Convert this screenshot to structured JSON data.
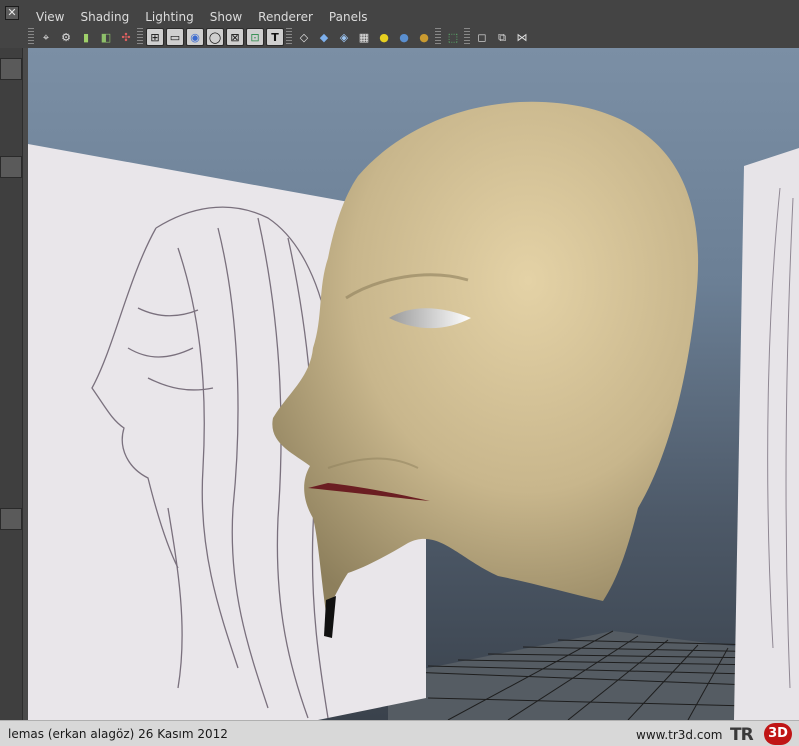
{
  "menubar": {
    "items": [
      "View",
      "Shading",
      "Lighting",
      "Show",
      "Renderer",
      "Panels"
    ]
  },
  "panel": {
    "close_glyph": "✕"
  },
  "toolbar": {
    "tools": [
      {
        "icon": "camera-select-icon",
        "glyph": "⌖"
      },
      {
        "icon": "camera-attributes-icon",
        "glyph": "⚙"
      },
      {
        "icon": "bookmarks-icon",
        "glyph": "▮"
      },
      {
        "icon": "image-plane-icon",
        "glyph": "◧"
      },
      {
        "icon": "camera-tools-icon",
        "glyph": "✣"
      },
      {
        "icon": "grid-toggle-icon",
        "glyph": "⊞"
      },
      {
        "icon": "film-gate-icon",
        "glyph": "▭"
      },
      {
        "icon": "resolution-gate-icon",
        "glyph": "◉"
      },
      {
        "icon": "gate-mask-icon",
        "glyph": "◯"
      },
      {
        "icon": "field-chart-icon",
        "glyph": "⊠"
      },
      {
        "icon": "safe-action-icon",
        "glyph": "⊡"
      },
      {
        "icon": "safe-title-icon",
        "glyph": "T"
      },
      {
        "icon": "wireframe-icon",
        "glyph": "◇"
      },
      {
        "icon": "smooth-shade-icon",
        "glyph": "◆"
      },
      {
        "icon": "shade-wireframe-icon",
        "glyph": "◈"
      },
      {
        "icon": "textured-icon",
        "glyph": "▦"
      },
      {
        "icon": "default-lighting-icon",
        "glyph": "●"
      },
      {
        "icon": "all-lights-icon",
        "glyph": "●"
      },
      {
        "icon": "shadows-icon",
        "glyph": "●"
      },
      {
        "icon": "isolate-select-icon",
        "glyph": "⬚"
      },
      {
        "icon": "xray-icon",
        "glyph": "◻"
      },
      {
        "icon": "xray-joints-icon",
        "glyph": "⧉"
      },
      {
        "icon": "xray-active-icon",
        "glyph": "⋈"
      }
    ]
  },
  "colors": {
    "viewport_top": "#7b8fa5",
    "viewport_bottom": "#3a424c",
    "head_skin": "#c8b68c",
    "accent_yellow": "#e8d020",
    "accent_blue": "#5a8fd0",
    "accent_gold": "#c99a30",
    "logo_red": "#c01515"
  },
  "statusbar": {
    "credit": "lemas (erkan alagöz)  26 Kasım 2012",
    "site": "www.tr3d.com",
    "logo_left": "TR",
    "logo_right": "3D"
  }
}
